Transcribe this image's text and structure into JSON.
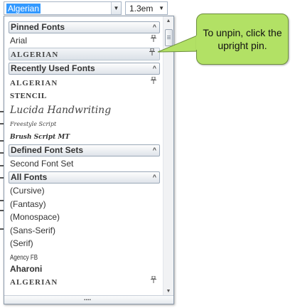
{
  "toolbar": {
    "font_value": "Algerian",
    "size_value": "1.3em"
  },
  "dropdown": {
    "sections": {
      "pinned": "Pinned Fonts",
      "recent": "Recently Used Fonts",
      "defined": "Defined Font Sets",
      "all": "All Fonts"
    },
    "pinned_items": [
      "Arial",
      "ALGERIAN"
    ],
    "recent_items": [
      "ALGERIAN",
      "STENCIL",
      "Lucida Handwriting",
      "Freestyle Script",
      "Brush Script MT"
    ],
    "defined_items": [
      "Second Font Set"
    ],
    "all_items": [
      "(Cursive)",
      "(Fantasy)",
      "(Monospace)",
      "(Sans-Serif)",
      "(Serif)",
      "Agency FB",
      "Aharoni",
      "ALGERIAN"
    ]
  },
  "callout": {
    "text": "To unpin, click the upright pin."
  },
  "colors": {
    "callout_fill": "#b2e165",
    "selection": "#3399ff"
  },
  "icons": [
    "dropdown-arrow-icon",
    "pin-icon",
    "chevron-up-icon",
    "scroll-up-icon",
    "scroll-down-icon",
    "gripper-icon"
  ]
}
